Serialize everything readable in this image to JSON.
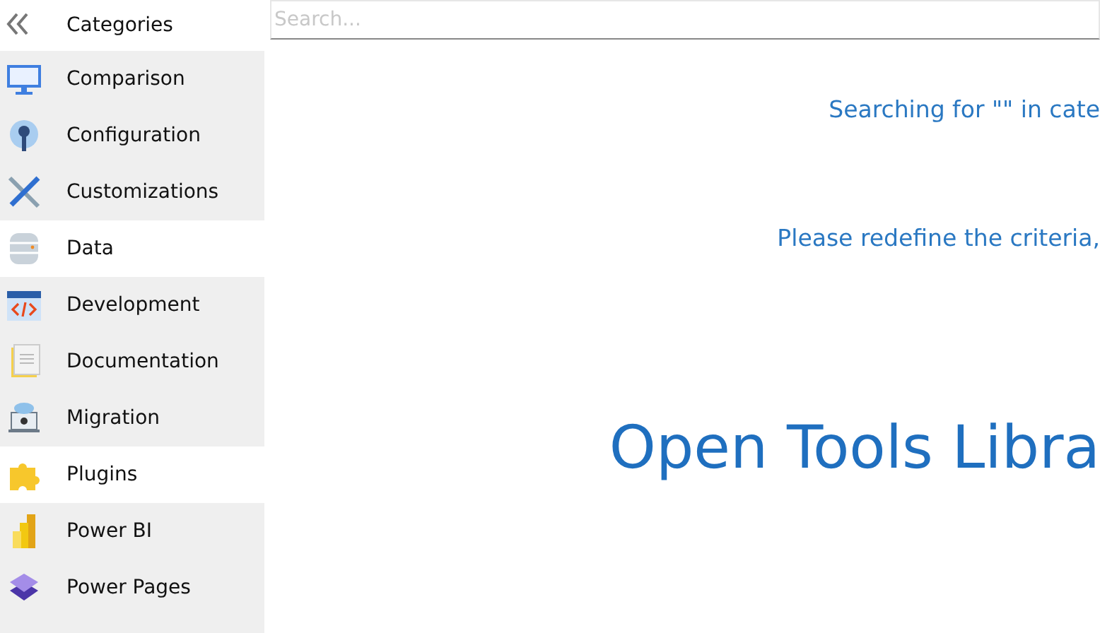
{
  "sidebar": {
    "title": "Categories",
    "items": [
      {
        "label": "Comparison",
        "kind": "comparison",
        "selected": false
      },
      {
        "label": "Configuration",
        "kind": "configuration",
        "selected": false
      },
      {
        "label": "Customizations",
        "kind": "customizations",
        "selected": false
      },
      {
        "label": "Data",
        "kind": "data",
        "selected": true
      },
      {
        "label": "Development",
        "kind": "development",
        "selected": false
      },
      {
        "label": "Documentation",
        "kind": "documentation",
        "selected": false
      },
      {
        "label": "Migration",
        "kind": "migration",
        "selected": false
      },
      {
        "label": "Plugins",
        "kind": "plugins",
        "selected": true
      },
      {
        "label": "Power BI",
        "kind": "powerbi",
        "selected": false
      },
      {
        "label": "Power Pages",
        "kind": "powerpages",
        "selected": false
      }
    ]
  },
  "search": {
    "placeholder": "Search..."
  },
  "messages": [
    "Searching for \"\" in cate",
    "Please redefine the criteria,"
  ],
  "banner": "Open Tools Libra"
}
